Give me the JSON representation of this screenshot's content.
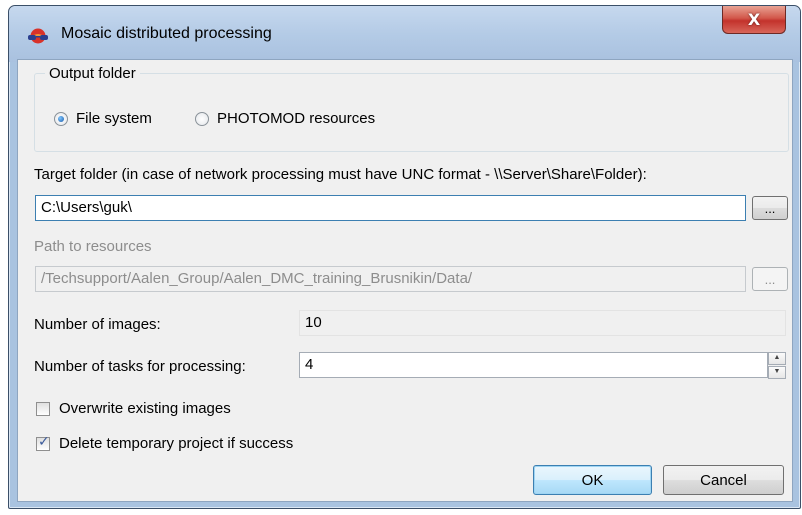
{
  "window": {
    "title": "Mosaic distributed processing",
    "close_label": "X"
  },
  "output_folder": {
    "group_title": "Output folder",
    "options": [
      {
        "label": "File system",
        "selected": true
      },
      {
        "label": "PHOTOMOD resources",
        "selected": false
      }
    ]
  },
  "target_folder": {
    "label": "Target folder (in case of network processing must have UNC format - \\\\Server\\Share\\Folder):",
    "value": "C:\\Users\\guk\\",
    "browse_label": "..."
  },
  "resources": {
    "label": "Path to resources",
    "value": "/Techsupport/Aalen_Group/Aalen_DMC_training_Brusnikin/Data/",
    "browse_label": "..."
  },
  "images": {
    "label": "Number of images:",
    "value": "10"
  },
  "tasks": {
    "label": "Number of tasks for processing:",
    "value": "4"
  },
  "options": {
    "overwrite": {
      "label": "Overwrite existing images",
      "checked": false
    },
    "delete_temp": {
      "label": "Delete temporary project if success",
      "checked": true
    }
  },
  "buttons": {
    "ok": "OK",
    "cancel": "Cancel"
  },
  "colors": {
    "title_bar": "#b4cbe6",
    "client_bg": "#f0f0f0",
    "close_red": "#c3322c",
    "focus_border": "#3c7fb1"
  },
  "icons": {
    "app": "globe-glasses-icon",
    "close": "close-icon"
  }
}
